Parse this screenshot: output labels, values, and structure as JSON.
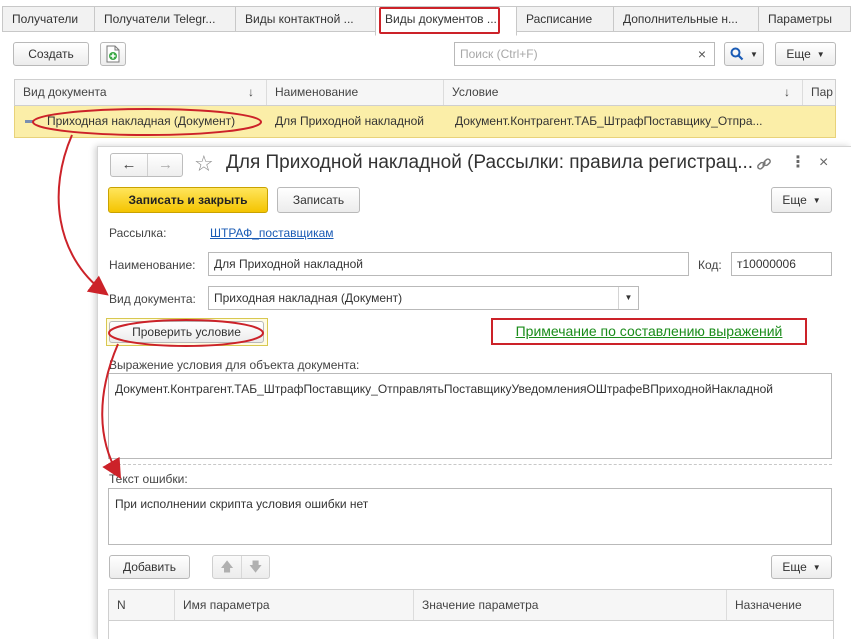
{
  "tabs": [
    {
      "label": "Получатели"
    },
    {
      "label": "Получатели Telegr..."
    },
    {
      "label": "Виды контактной ..."
    },
    {
      "label": "Виды документов ..."
    },
    {
      "label": "Расписание"
    },
    {
      "label": "Дополнительные н..."
    },
    {
      "label": "Параметры"
    }
  ],
  "list_toolbar": {
    "create_label": "Создать",
    "search_placeholder": "Поиск (Ctrl+F)",
    "clear_symbol": "×",
    "more_label": "Еще"
  },
  "list": {
    "columns": [
      "Вид документа",
      "Наименование",
      "Условие",
      "Пар"
    ],
    "sort_marker": "↓",
    "row": {
      "doc_type": "Приходная накладная (Документ)",
      "name": "Для Приходной накладной",
      "condition": "Документ.Контрагент.ТАБ_ШтрафПоставщику_Отпра..."
    }
  },
  "dialog": {
    "title": "Для Приходной накладной (Рассылки: правила регистрац...",
    "back_symbol": "←",
    "forward_symbol": "→",
    "star_symbol": "☆",
    "link_symbol": "🔗",
    "menu_symbol": "⋮",
    "close_symbol": "×",
    "save_close_label": "Записать и закрыть",
    "save_label": "Записать",
    "more_label": "Еще",
    "mailing_label": "Рассылка:",
    "mailing_value": "ШТРАФ_поставщикам",
    "name_label": "Наименование:",
    "name_value": "Для Приходной накладной",
    "code_label": "Код:",
    "code_value": "т10000006",
    "doc_type_label": "Вид документа:",
    "doc_type_value": "Приходная накладная (Документ)",
    "check_button": "Проверить условие",
    "note_link": "Примечание по составлению выражений",
    "expr_label": "Выражение условия для объекта документа:",
    "expr_value": "Документ.Контрагент.ТАБ_ШтрафПоставщику_ОтправлятьПоставщикуУведомленияОШтрафеВПриходнойНакладной",
    "error_label": "Текст ошибки:",
    "error_value": "При исполнении скрипта условия ошибки нет",
    "add_label": "Добавить",
    "up_symbol": "🡅",
    "down_symbol": "🡇",
    "params_more_label": "Еще",
    "params_columns": [
      "N",
      "Имя параметра",
      "Значение параметра",
      "Назначение"
    ]
  },
  "colors": {
    "accent_yellow": "#f4c400",
    "annotation_red": "#cc2229",
    "link_blue": "#1a5bb5",
    "note_green": "#1a8c1a",
    "selected_row": "#fbeea8"
  }
}
